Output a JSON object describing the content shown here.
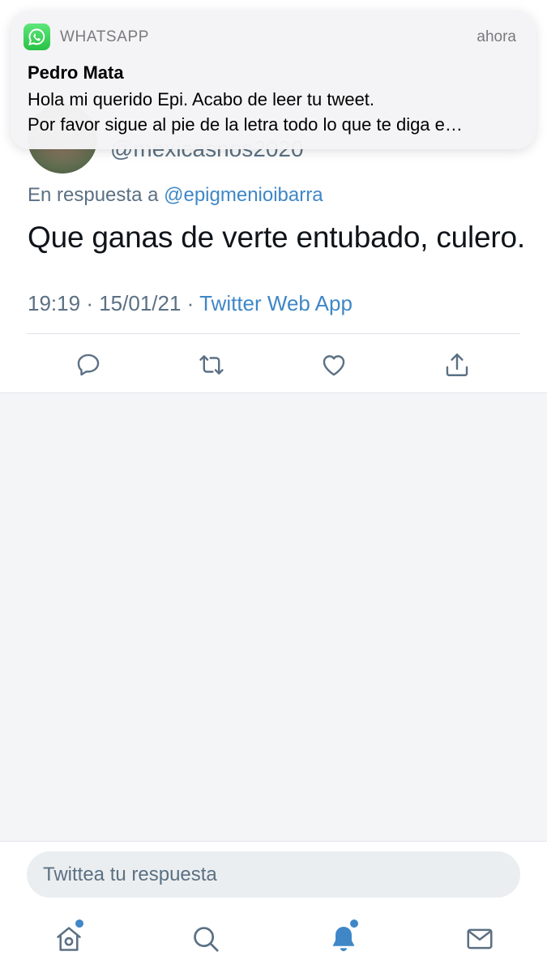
{
  "notification": {
    "app_name": "WHATSAPP",
    "time": "ahora",
    "sender": "Pedro Mata",
    "message_line1": "Hola mi querido Epi. Acabo de leer tu tweet.",
    "message_line2": "Por favor sigue al pie de la letra todo lo que te diga e…",
    "app_icon": "whatsapp-icon",
    "icon_color": "#25D366"
  },
  "tweet": {
    "handle": "@mexicasnos2020",
    "reply_prefix": "En respuesta a",
    "reply_mention": "@epigmenioibarra",
    "text": "Que ganas de verte entubado, culero.",
    "time": "19:19",
    "date": "15/01/21",
    "separator": "·",
    "source": "Twitter Web App",
    "link_color": "#3F87C7"
  },
  "actions": [
    {
      "name": "reply",
      "icon": "reply-icon"
    },
    {
      "name": "retweet",
      "icon": "retweet-icon"
    },
    {
      "name": "like",
      "icon": "heart-icon"
    },
    {
      "name": "share",
      "icon": "share-icon"
    }
  ],
  "reply_box": {
    "placeholder": "Twittea tu respuesta"
  },
  "tab_bar": {
    "tabs": [
      {
        "name": "home",
        "icon": "home-icon",
        "has_badge": true
      },
      {
        "name": "search",
        "icon": "search-icon",
        "has_badge": false
      },
      {
        "name": "notifications",
        "icon": "bell-icon",
        "has_badge": true,
        "active": true
      },
      {
        "name": "messages",
        "icon": "mail-icon",
        "has_badge": false
      }
    ],
    "accent_color": "#3F87C7"
  }
}
